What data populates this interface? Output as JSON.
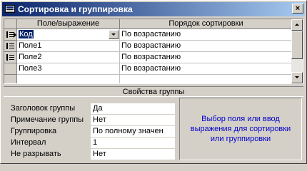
{
  "window": {
    "title": "Сортировка и группировка",
    "close_label": "×"
  },
  "grid": {
    "columns": [
      "Поле/выражение",
      "Порядок сортировки"
    ],
    "rows": [
      {
        "field": "Код",
        "order": "По возрастанию",
        "selected": true
      },
      {
        "field": "Поле1",
        "order": "По возрастанию"
      },
      {
        "field": "Поле2",
        "order": "По возрастанию"
      },
      {
        "field": "Поле3",
        "order": "По возрастанию"
      },
      {
        "field": "",
        "order": ""
      }
    ]
  },
  "properties": {
    "header": "Свойства группы",
    "items": [
      {
        "label": "Заголовок группы",
        "value": "Да"
      },
      {
        "label": "Примечание группы",
        "value": "Нет"
      },
      {
        "label": "Группировка",
        "value": "По полному значен"
      },
      {
        "label": "Интервал",
        "value": "1"
      },
      {
        "label": "Не разрывать",
        "value": "Нет"
      }
    ],
    "hint": "Выбор поля или ввод выражения для сортировки или группировки"
  },
  "colors": {
    "title_start": "#0a246a",
    "title_end": "#a6caf0",
    "hint_text": "#0000cc"
  }
}
